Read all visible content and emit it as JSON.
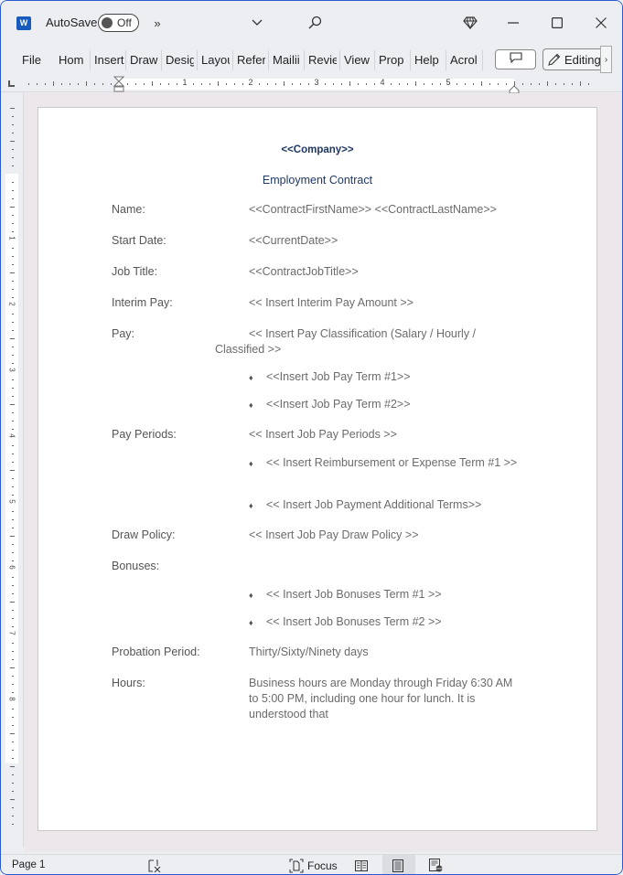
{
  "app": {
    "name": "Word",
    "autosave_label": "AutoSave",
    "autosave_state": "Off",
    "icons": [
      "word-logo-icon",
      "more-commands-icon",
      "customize-dropdown-icon",
      "search-icon",
      "premium-diamond-icon",
      "minimize-icon",
      "maximize-icon",
      "close-icon"
    ]
  },
  "ribbon": {
    "tabs": [
      {
        "label": "File"
      },
      {
        "label": "Home"
      },
      {
        "label": "Insert"
      },
      {
        "label": "Draw"
      },
      {
        "label": "Design"
      },
      {
        "label": "Layout"
      },
      {
        "label": "References"
      },
      {
        "label": "Mailings"
      },
      {
        "label": "Review"
      },
      {
        "label": "View"
      },
      {
        "label": "Properties"
      },
      {
        "label": "Help"
      },
      {
        "label": "Acrobat"
      }
    ],
    "tab_visible_text": [
      "File",
      "Hom",
      "Insert",
      "Draw",
      "Desig",
      "Layou",
      "Refer",
      "Mailii",
      "Revie",
      "View",
      "Prop",
      "Help",
      "Acrol"
    ],
    "comment_button": "comments-icon",
    "editing_label": "Editing",
    "more_label": "›"
  },
  "ruler": {
    "horizontal_numbers": [
      "1",
      "2",
      "3",
      "4",
      "5"
    ],
    "vertical_numbers": [
      "1",
      "2",
      "3",
      "4",
      "5",
      "6",
      "7",
      "8"
    ]
  },
  "document": {
    "company": "<<Company>>",
    "title": "Employment Contract",
    "fields": {
      "name_label": "Name:",
      "name_value": "<<ContractFirstName>> <<ContractLastName>>",
      "start_label": "Start Date:",
      "start_value": "<<CurrentDate>>",
      "job_label": "Job Title:",
      "job_value": "<<ContractJobTitle>>",
      "interim_label": "Interim Pay:",
      "interim_value": "<< Insert Interim Pay Amount >>",
      "pay_label": "Pay:",
      "pay_value_line1": "<< Insert Pay Classification (Salary / Hourly /",
      "pay_value_line2": "Classified >>",
      "pay_terms": [
        "<<Insert Job Pay Term #1>>",
        "<<Insert Job Pay Term #2>>"
      ],
      "periods_label": "Pay Periods:",
      "periods_value": "<< Insert Job Pay Periods >>",
      "period_terms": [
        "<< Insert Reimbursement or Expense Term #1 >>",
        "<< Insert Job Payment Additional Terms>>"
      ],
      "draw_label": "Draw Policy:",
      "draw_value": "<< Insert Job Pay Draw Policy >>",
      "bonuses_label": "Bonuses:",
      "bonus_terms": [
        "<< Insert Job Bonuses Term #1 >>",
        "<< Insert Job Bonuses Term #2 >>"
      ],
      "probation_label": "Probation Period:",
      "probation_value": "Thirty/Sixty/Ninety days",
      "hours_label": "Hours:",
      "hours_value": "Business hours are Monday through Friday 6:30 AM to 5:00 PM, including one hour for lunch.  It is understood that"
    },
    "bullet_glyph": "♦"
  },
  "statusbar": {
    "page": "Page 1",
    "focus_label": "Focus",
    "views": [
      "read-mode-icon",
      "print-layout-icon",
      "web-layout-icon"
    ],
    "active_view": "print-layout"
  },
  "colors": {
    "heading": "#1f3864",
    "label": "#555555",
    "value": "#6b6b6b",
    "window_border": "#2a5bd0",
    "word_blue": "#185abd"
  }
}
